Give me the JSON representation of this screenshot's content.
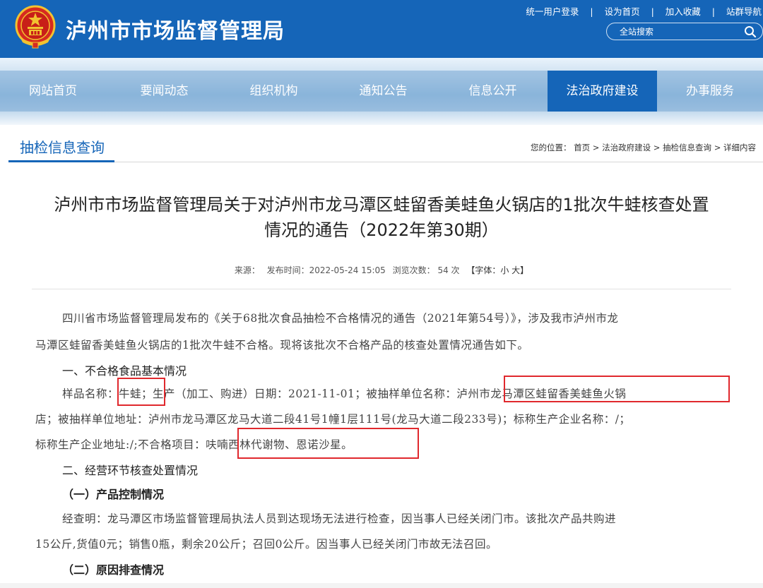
{
  "header": {
    "site_title": "泸州市市场监督管理局",
    "links": [
      "统一用户登录",
      "设为首页",
      "加入收藏",
      "站群导航"
    ],
    "search_placeholder": "全站搜索"
  },
  "nav": {
    "items": [
      "网站首页",
      "要闻动态",
      "组织机构",
      "通知公告",
      "信息公开",
      "法治政府建设",
      "办事服务"
    ],
    "active_index": 5
  },
  "section": {
    "title": "抽检信息查询",
    "breadcrumb": "您的位置： 首页 > 法治政府建设 > 抽检信息查询 > 详细内容"
  },
  "article": {
    "title_line1": "泸州市市场监督管理局关于对泸州市龙马潭区蛙留香美蛙鱼火锅店的1批次牛蛙核查处置",
    "title_line2": "情况的通告（2022年第30期）",
    "meta": {
      "source_label": "来源：",
      "publish_time": "发布时间：2022-05-24 15:05",
      "views": "浏览次数： 54 次",
      "font_size": "【字体：小 大】"
    },
    "paragraphs": [
      "四川省市场监督管理局发布的《关于68批次食品抽检不合格情况的通告（2021年第54号）》，涉及我市泸州市龙",
      "马潭区蛙留香美蛙鱼火锅店的1批次牛蛙不合格。现将该批次不合格产品的核查处置情况通告如下。",
      "一、不合格食品基本情况",
      "样品名称：牛蛙；生产（加工、购进）日期：2021-11-01；被抽样单位名称：泸州市龙马潭区蛙留香美蛙鱼火锅",
      "店；被抽样单位地址：泸州市龙马潭区龙马大道二段41号1幢1层111号(龙马大道二段233号)；标称生产企业名称：/；",
      "标称生产企业地址:/;不合格项目：呋喃西林代谢物、恩诺沙星。",
      "二、经营环节核查处置情况",
      "（一）产品控制情况",
      "经查明：龙马潭区市场监督管理局执法人员到达现场无法进行检查，因当事人已经关闭门市。该批次产品共购进",
      "15公斤,货值0元；销售0瓶，剩余20公斤；召回0公斤。因当事人已经关闭门市故无法召回。",
      "（二）原因排查情况"
    ]
  },
  "colors": {
    "header_blue": "#1565b8",
    "highlight_red": "#e0282d"
  }
}
